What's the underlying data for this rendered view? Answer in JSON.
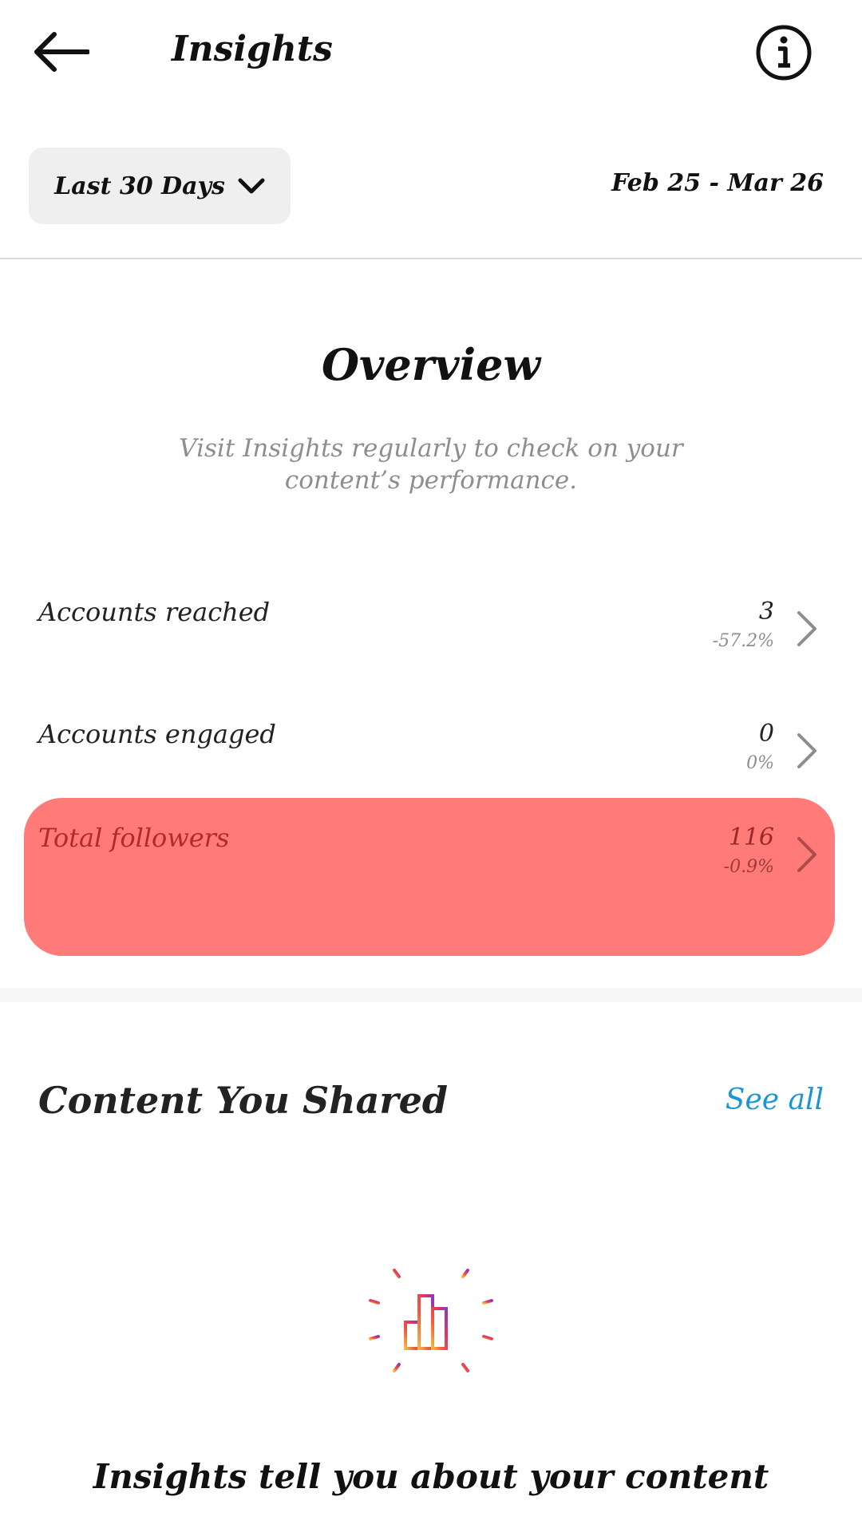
{
  "header": {
    "title": "Insights",
    "back_icon": "arrow-left-icon",
    "info_icon": "info-icon"
  },
  "filter": {
    "range_label": "Last 30 Days",
    "range_icon": "chevron-down-icon",
    "date_range": "Feb 25 - Mar 26"
  },
  "overview": {
    "title": "Overview",
    "subtitle": "Visit Insights regularly to check on your content’s performance.",
    "metrics": [
      {
        "label": "Accounts reached",
        "value": "3",
        "change": "-57.2%"
      },
      {
        "label": "Accounts engaged",
        "value": "0",
        "change": "0%"
      },
      {
        "label": "Total followers",
        "value": "116",
        "change": "-0.9%",
        "highlighted": true
      }
    ]
  },
  "content_shared": {
    "title": "Content You Shared",
    "see_all_label": "See all",
    "empty_icon": "insights-chart-icon",
    "empty_title": "Insights tell you about your content"
  },
  "colors": {
    "highlight": "#ff7b79",
    "link": "#1a96d6",
    "muted": "#8e8e8e"
  }
}
